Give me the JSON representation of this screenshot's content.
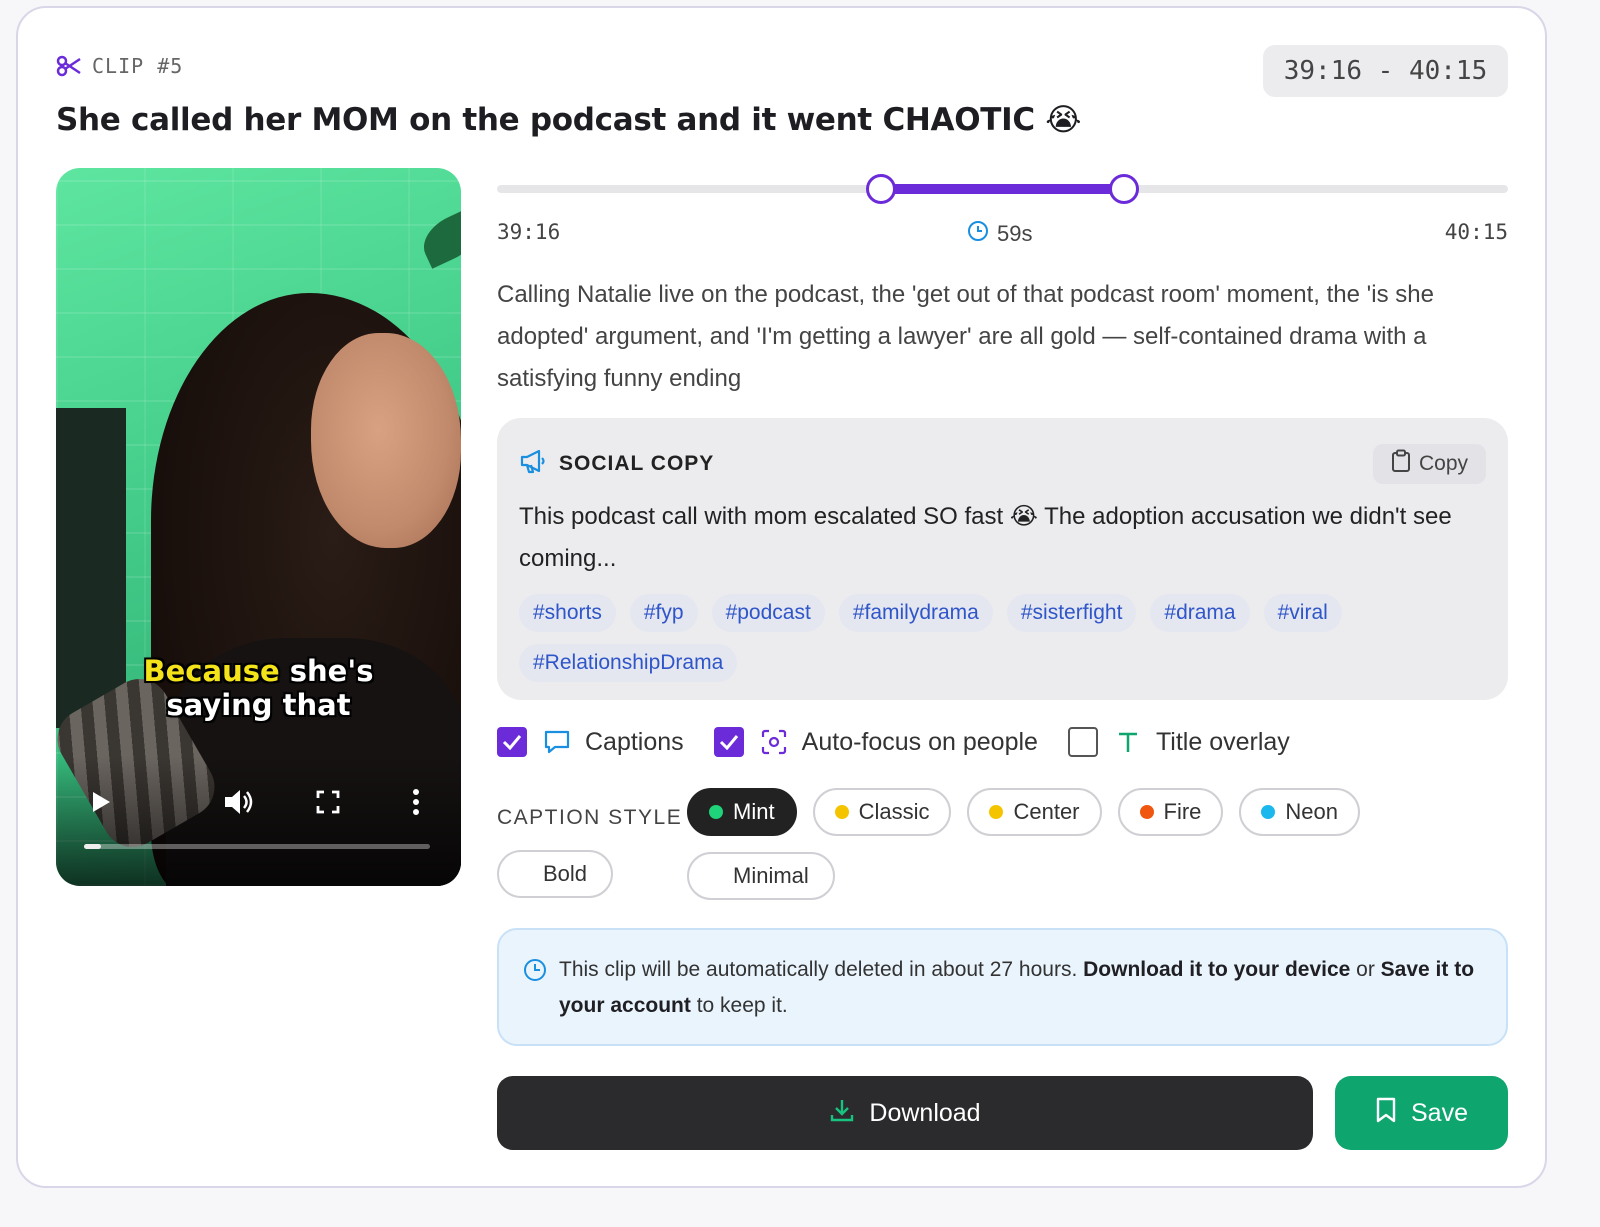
{
  "clip": {
    "label": "CLIP #5",
    "time_range": "39:16 - 40:15",
    "title": "She called her MOM on the podcast and it went CHAOTIC 😭"
  },
  "video": {
    "caption_highlight": "Because",
    "caption_rest_line1": "she's",
    "caption_line2": "saying that",
    "progress_fraction": 0.05
  },
  "trim": {
    "start": "39:16",
    "end": "40:15",
    "duration": "59s",
    "selection_start_fraction": 0.38,
    "selection_end_fraction": 0.62
  },
  "description": "Calling Natalie live on the podcast, the 'get out of that podcast room' moment, the 'is she adopted' argument, and 'I'm getting a lawyer' are all gold — self-contained drama with a satisfying funny ending",
  "social_copy": {
    "heading": "SOCIAL COPY",
    "copy_button": "Copy",
    "text": "This podcast call with mom escalated SO fast 😭 The adoption accusation we didn't see coming...",
    "hashtags": [
      "#shorts",
      "#fyp",
      "#podcast",
      "#familydrama",
      "#sisterfight",
      "#drama",
      "#viral",
      "#RelationshipDrama"
    ]
  },
  "options": {
    "captions": {
      "label": "Captions",
      "checked": true
    },
    "autofocus": {
      "label": "Auto-focus on people",
      "checked": true
    },
    "title_overlay": {
      "label": "Title overlay",
      "checked": false
    }
  },
  "caption_style": {
    "label": "CAPTION STYLE",
    "styles": [
      {
        "name": "Mint",
        "dot": "#1ed37a",
        "active": true
      },
      {
        "name": "Classic",
        "dot": "#f5c400",
        "active": false
      },
      {
        "name": "Center",
        "dot": "#f5c400",
        "active": false
      },
      {
        "name": "Fire",
        "dot": "#f0560f",
        "active": false
      },
      {
        "name": "Neon",
        "dot": "#1bb8ee",
        "active": false
      },
      {
        "name": "Minimal",
        "dot": null,
        "active": false
      },
      {
        "name": "Bold",
        "dot": null,
        "active": false
      }
    ]
  },
  "notice": {
    "text_1": "This clip will be automatically deleted in about 27 hours. ",
    "bold_1": "Download it to your device",
    "text_2": " or ",
    "bold_2": "Save it to your account",
    "text_3": " to keep it."
  },
  "actions": {
    "download": "Download",
    "save": "Save"
  },
  "colors": {
    "accent": "#6c2bd9",
    "save_green": "#0fa56f",
    "download_dark": "#2b2b2d",
    "hashtag_blue": "#2f56c9",
    "caption_highlight": "#f5e31a"
  },
  "icons": [
    "scissors-icon",
    "clock-icon",
    "megaphone-icon",
    "clipboard-icon",
    "speech-bubble-icon",
    "focus-frame-icon",
    "text-t-icon",
    "download-icon",
    "bookmark-icon",
    "play-icon",
    "volume-icon",
    "fullscreen-icon",
    "more-vertical-icon"
  ]
}
